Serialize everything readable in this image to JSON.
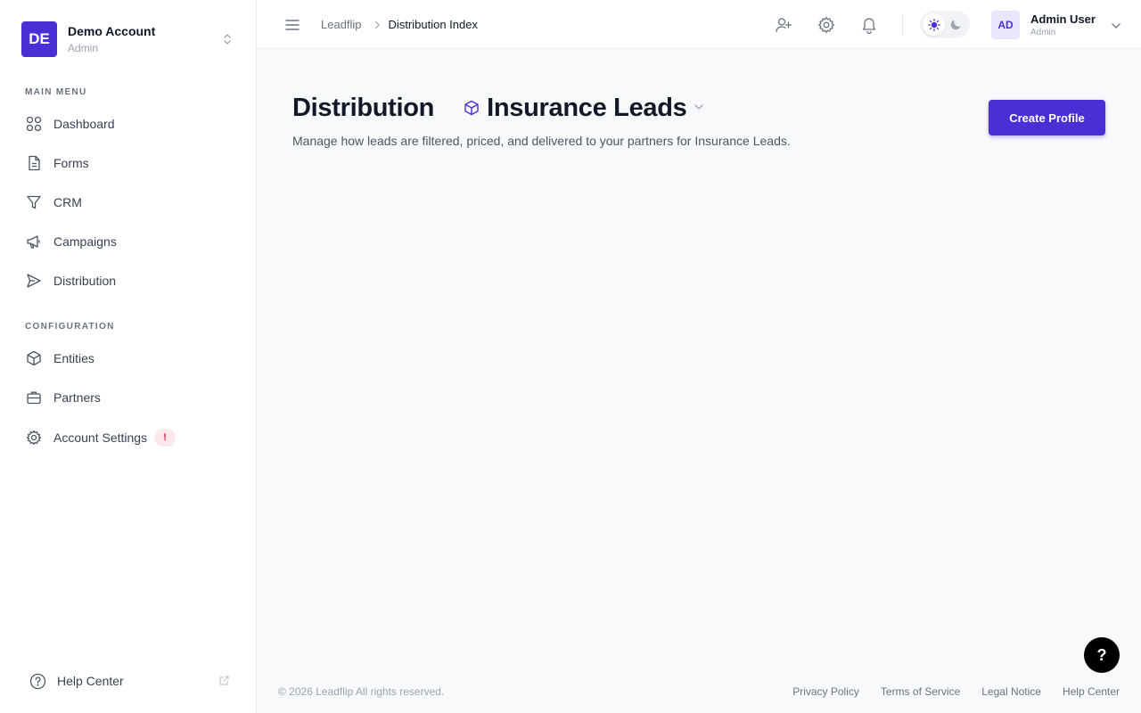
{
  "account": {
    "initials": "DE",
    "name": "Demo Account",
    "role": "Admin"
  },
  "sidebar": {
    "main_menu_title": "MAIN MENU",
    "main_items": [
      {
        "label": "Dashboard",
        "icon": "grid-icon"
      },
      {
        "label": "Forms",
        "icon": "document-icon"
      },
      {
        "label": "CRM",
        "icon": "filter-icon"
      },
      {
        "label": "Campaigns",
        "icon": "megaphone-icon"
      },
      {
        "label": "Distribution",
        "icon": "send-icon"
      }
    ],
    "config_title": "CONFIGURATION",
    "config_items": [
      {
        "label": "Entities",
        "icon": "cube-icon"
      },
      {
        "label": "Partners",
        "icon": "briefcase-icon"
      },
      {
        "label": "Account Settings",
        "icon": "gear-icon",
        "badge": "!"
      }
    ],
    "help_center": "Help Center"
  },
  "breadcrumb": {
    "root": "Leadflip",
    "current": "Distribution Index"
  },
  "user": {
    "initials": "AD",
    "name": "Admin User",
    "role": "Admin"
  },
  "page": {
    "title": "Distribution",
    "entity": "Insurance Leads",
    "description": "Manage how leads are filtered, priced, and delivered to your partners for Insurance Leads.",
    "create_button": "Create Profile"
  },
  "footer": {
    "copyright": "© 2026 Leadflip All rights reserved.",
    "links": [
      "Privacy Policy",
      "Terms of Service",
      "Legal Notice",
      "Help Center"
    ]
  },
  "help_fab": "?",
  "colors": {
    "accent": "#4a2fd6",
    "badge_bg": "#fde8ec",
    "badge_text": "#e11d48"
  }
}
